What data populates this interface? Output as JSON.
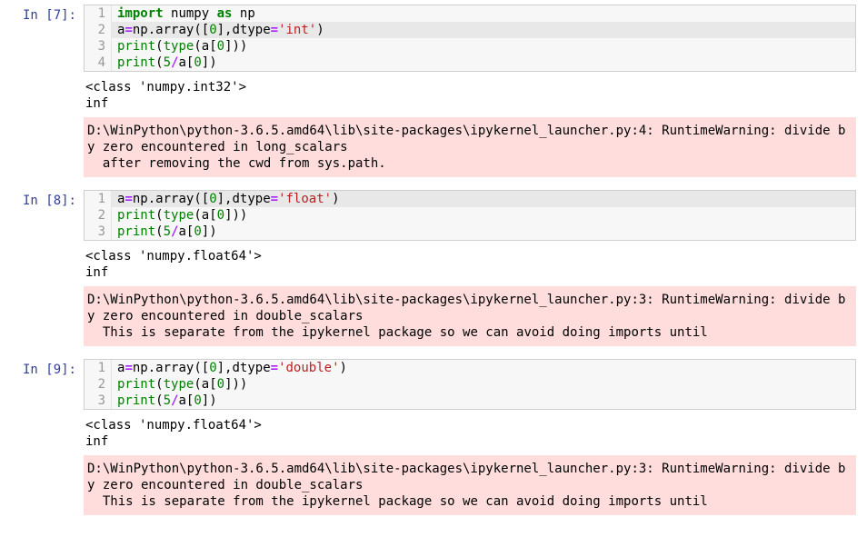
{
  "cells": [
    {
      "prompt": "In [7]:",
      "code": [
        {
          "n": "1",
          "tokens": [
            [
              "kw",
              "import"
            ],
            [
              "sp",
              " "
            ],
            [
              "nm",
              "numpy"
            ],
            [
              "sp",
              " "
            ],
            [
              "kw",
              "as"
            ],
            [
              "sp",
              " "
            ],
            [
              "nm",
              "np"
            ]
          ],
          "hl": false
        },
        {
          "n": "2",
          "tokens": [
            [
              "nm",
              "a"
            ],
            [
              "op",
              "="
            ],
            [
              "nm",
              "np"
            ],
            [
              "p",
              "."
            ],
            [
              "nm",
              "array"
            ],
            [
              "p",
              "(["
            ],
            [
              "nnum",
              "0"
            ],
            [
              "p",
              "],"
            ],
            [
              "nm",
              "dtype"
            ],
            [
              "op",
              "="
            ],
            [
              "str",
              "'int'"
            ],
            [
              "p",
              ")"
            ]
          ],
          "hl": true
        },
        {
          "n": "3",
          "tokens": [
            [
              "bi",
              "print"
            ],
            [
              "p",
              "("
            ],
            [
              "bi",
              "type"
            ],
            [
              "p",
              "("
            ],
            [
              "nm",
              "a"
            ],
            [
              "p",
              "["
            ],
            [
              "nnum",
              "0"
            ],
            [
              "p",
              "]))"
            ]
          ],
          "hl": false
        },
        {
          "n": "4",
          "tokens": [
            [
              "bi",
              "print"
            ],
            [
              "p",
              "("
            ],
            [
              "nnum",
              "5"
            ],
            [
              "op",
              "/"
            ],
            [
              "nm",
              "a"
            ],
            [
              "p",
              "["
            ],
            [
              "nnum",
              "0"
            ],
            [
              "p",
              "])"
            ]
          ],
          "hl": false
        }
      ],
      "stdout": "<class 'numpy.int32'>\ninf",
      "stderr": "D:\\WinPython\\python-3.6.5.amd64\\lib\\site-packages\\ipykernel_launcher.py:4: RuntimeWarning: divide by zero encountered in long_scalars\n  after removing the cwd from sys.path."
    },
    {
      "prompt": "In [8]:",
      "code": [
        {
          "n": "1",
          "tokens": [
            [
              "nm",
              "a"
            ],
            [
              "op",
              "="
            ],
            [
              "nm",
              "np"
            ],
            [
              "p",
              "."
            ],
            [
              "nm",
              "array"
            ],
            [
              "p",
              "(["
            ],
            [
              "nnum",
              "0"
            ],
            [
              "p",
              "],"
            ],
            [
              "nm",
              "dtype"
            ],
            [
              "op",
              "="
            ],
            [
              "str",
              "'float'"
            ],
            [
              "p",
              ")"
            ]
          ],
          "hl": true
        },
        {
          "n": "2",
          "tokens": [
            [
              "bi",
              "print"
            ],
            [
              "p",
              "("
            ],
            [
              "bi",
              "type"
            ],
            [
              "p",
              "("
            ],
            [
              "nm",
              "a"
            ],
            [
              "p",
              "["
            ],
            [
              "nnum",
              "0"
            ],
            [
              "p",
              "]))"
            ]
          ],
          "hl": false
        },
        {
          "n": "3",
          "tokens": [
            [
              "bi",
              "print"
            ],
            [
              "p",
              "("
            ],
            [
              "nnum",
              "5"
            ],
            [
              "op",
              "/"
            ],
            [
              "nm",
              "a"
            ],
            [
              "p",
              "["
            ],
            [
              "nnum",
              "0"
            ],
            [
              "p",
              "])"
            ]
          ],
          "hl": false
        }
      ],
      "stdout": "<class 'numpy.float64'>\ninf",
      "stderr": "D:\\WinPython\\python-3.6.5.amd64\\lib\\site-packages\\ipykernel_launcher.py:3: RuntimeWarning: divide by zero encountered in double_scalars\n  This is separate from the ipykernel package so we can avoid doing imports until"
    },
    {
      "prompt": "In [9]:",
      "code": [
        {
          "n": "1",
          "tokens": [
            [
              "nm",
              "a"
            ],
            [
              "op",
              "="
            ],
            [
              "nm",
              "np"
            ],
            [
              "p",
              "."
            ],
            [
              "nm",
              "array"
            ],
            [
              "p",
              "(["
            ],
            [
              "nnum",
              "0"
            ],
            [
              "p",
              "],"
            ],
            [
              "nm",
              "dtype"
            ],
            [
              "op",
              "="
            ],
            [
              "str",
              "'double'"
            ],
            [
              "p",
              ")"
            ]
          ],
          "hl": false
        },
        {
          "n": "2",
          "tokens": [
            [
              "bi",
              "print"
            ],
            [
              "p",
              "("
            ],
            [
              "bi",
              "type"
            ],
            [
              "p",
              "("
            ],
            [
              "nm",
              "a"
            ],
            [
              "p",
              "["
            ],
            [
              "nnum",
              "0"
            ],
            [
              "p",
              "]))"
            ]
          ],
          "hl": false
        },
        {
          "n": "3",
          "tokens": [
            [
              "bi",
              "print"
            ],
            [
              "p",
              "("
            ],
            [
              "nnum",
              "5"
            ],
            [
              "op",
              "/"
            ],
            [
              "nm",
              "a"
            ],
            [
              "p",
              "["
            ],
            [
              "nnum",
              "0"
            ],
            [
              "p",
              "])"
            ]
          ],
          "hl": false
        }
      ],
      "stdout": "<class 'numpy.float64'>\ninf",
      "stderr": "D:\\WinPython\\python-3.6.5.amd64\\lib\\site-packages\\ipykernel_launcher.py:3: RuntimeWarning: divide by zero encountered in double_scalars\n  This is separate from the ipykernel package so we can avoid doing imports until"
    }
  ]
}
